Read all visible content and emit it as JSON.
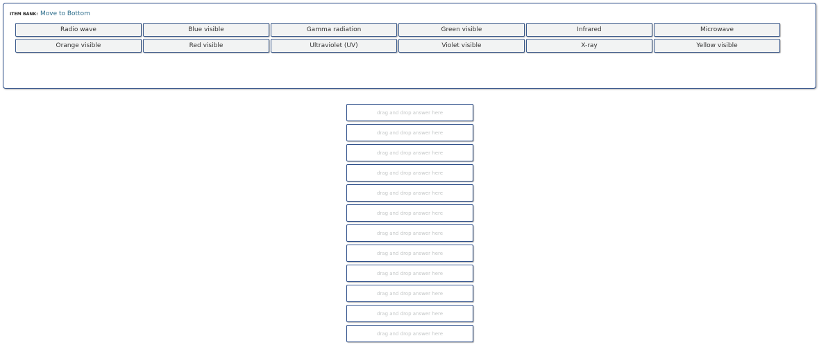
{
  "item_bank": {
    "label": "ITEM BANK:",
    "move_link": "Move to Bottom",
    "items": [
      "Radio wave",
      "Blue visible",
      "Gamma radiation",
      "Green visible",
      "Infrared",
      "Microwave",
      "Orange visible",
      "Red visible",
      "Ultraviolet (UV)",
      "Violet visible",
      "X-ray",
      "Yellow visible"
    ]
  },
  "drop_zones": {
    "placeholder": "drag and drop answer here",
    "count": 12
  },
  "colors": {
    "border": "#2e4f8a",
    "item_bg": "#f2f3f3",
    "link": "#2a6b8a",
    "placeholder": "#c4c7c7"
  }
}
